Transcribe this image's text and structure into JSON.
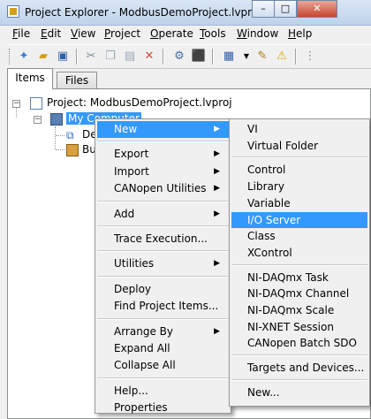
{
  "window": {
    "title": "Project Explorer - ModbusDemoProject.lvpro...",
    "buttons": {
      "minimize": "–",
      "maximize": "□",
      "close": "✕"
    }
  },
  "menubar": [
    {
      "underline": "F",
      "rest": "ile"
    },
    {
      "underline": "E",
      "rest": "dit"
    },
    {
      "underline": "V",
      "rest": "iew"
    },
    {
      "underline": "P",
      "rest": "roject"
    },
    {
      "underline": "O",
      "rest": "perate"
    },
    {
      "underline": "T",
      "rest": "ools"
    },
    {
      "underline": "W",
      "rest": "indow"
    },
    {
      "underline": "H",
      "rest": "elp"
    }
  ],
  "toolbar_icons": [
    "new-file-icon",
    "open-folder-icon",
    "save-all-icon",
    "cut-icon",
    "copy-icon",
    "paste-icon",
    "delete-icon",
    "build-icon",
    "deploy-icon",
    "view-as-icon",
    "properties-icon",
    "warning-icon",
    "more-icon"
  ],
  "tabs": {
    "items": "Items",
    "files": "Files"
  },
  "tree": {
    "project": "Project: ModbusDemoProject.lvproj",
    "my_computer": "My Computer",
    "dependencies": "De",
    "build_specs": "Bu"
  },
  "context_menu": [
    {
      "label": "New",
      "submenu": true,
      "highlighted": true
    },
    {
      "sep": true
    },
    {
      "label": "Export",
      "submenu": true
    },
    {
      "label": "Import",
      "submenu": true
    },
    {
      "label": "CANopen Utilities",
      "submenu": true
    },
    {
      "sep": true
    },
    {
      "label": "Add",
      "submenu": true
    },
    {
      "sep": true
    },
    {
      "label": "Trace Execution..."
    },
    {
      "sep": true
    },
    {
      "label": "Utilities",
      "submenu": true
    },
    {
      "sep": true
    },
    {
      "label": "Deploy"
    },
    {
      "label": "Find Project Items..."
    },
    {
      "sep": true
    },
    {
      "label": "Arrange By",
      "submenu": true
    },
    {
      "label": "Expand All"
    },
    {
      "label": "Collapse All"
    },
    {
      "sep": true
    },
    {
      "label": "Help..."
    },
    {
      "label": "Properties"
    }
  ],
  "submenu_new": [
    {
      "label": "VI"
    },
    {
      "label": "Virtual Folder"
    },
    {
      "sep": true
    },
    {
      "label": "Control"
    },
    {
      "label": "Library"
    },
    {
      "label": "Variable"
    },
    {
      "label": "I/O Server",
      "highlighted": true
    },
    {
      "label": "Class"
    },
    {
      "label": "XControl"
    },
    {
      "sep": true
    },
    {
      "label": "NI-DAQmx Task"
    },
    {
      "label": "NI-DAQmx Channel"
    },
    {
      "label": "NI-DAQmx Scale"
    },
    {
      "label": "NI-XNET Session"
    },
    {
      "label": "CANopen Batch SDO"
    },
    {
      "sep": true
    },
    {
      "label": "Targets and Devices..."
    },
    {
      "sep": true
    },
    {
      "label": "New..."
    }
  ],
  "colors": {
    "highlight": "#3399ff",
    "menu_bg": "#f0f0f0",
    "title_bg": "#cfdcec"
  }
}
